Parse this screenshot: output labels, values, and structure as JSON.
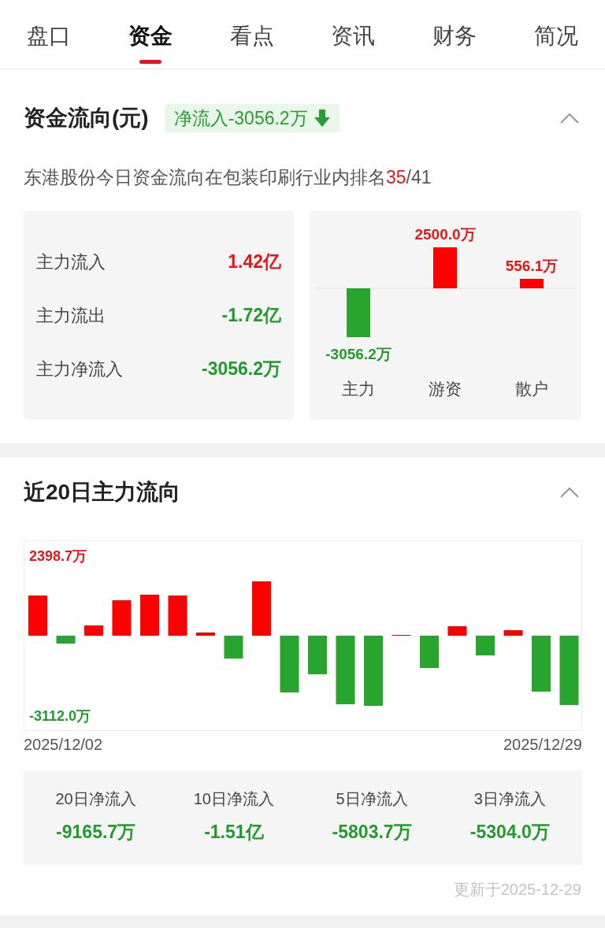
{
  "tabs": [
    {
      "label": "盘口",
      "selected": false
    },
    {
      "label": "资金",
      "selected": true
    },
    {
      "label": "看点",
      "selected": false
    },
    {
      "label": "资讯",
      "selected": false
    },
    {
      "label": "财务",
      "selected": false
    },
    {
      "label": "简况",
      "selected": false
    }
  ],
  "flow_section": {
    "title": "资金流向(元)",
    "badge": "净流入-3056.2万",
    "expanded": true,
    "summary": "东港股份今日资金流向在包装印刷行业内排名**35**/41",
    "stats": [
      {
        "label": "主力流入",
        "value": "1.42亿",
        "color": "#e4161b"
      },
      {
        "label": "主力流出",
        "value": "-1.72亿",
        "color": "#229a2c"
      },
      {
        "label": "主力净流入",
        "value": "-3056.2万",
        "color": "#229a2c"
      }
    ],
    "bars": [
      {
        "category": "主力",
        "amount": "-3056.2万",
        "color": "#27a52c"
      },
      {
        "category": "游资",
        "amount": "2500.0万",
        "color": "#ff0000"
      },
      {
        "category": "散户",
        "amount": "556.1万",
        "color": "#ff0000"
      }
    ]
  },
  "trend_section": {
    "title": "近20日主力流向",
    "expanded": true,
    "max_label": "2398.7万",
    "min_label": "-3112.0万",
    "start_date": "2025/12/02",
    "end_date": "2025/12/29",
    "totals": [
      {
        "label": "20日净流入",
        "value": "-9165.7万"
      },
      {
        "label": "10日净流入",
        "value": "-1.51亿"
      },
      {
        "label": "5日净流入",
        "value": "-5803.7万"
      },
      {
        "label": "3日净流入",
        "value": "-5304.0万"
      }
    ],
    "updated": "更新于2025-12-29"
  }
}
